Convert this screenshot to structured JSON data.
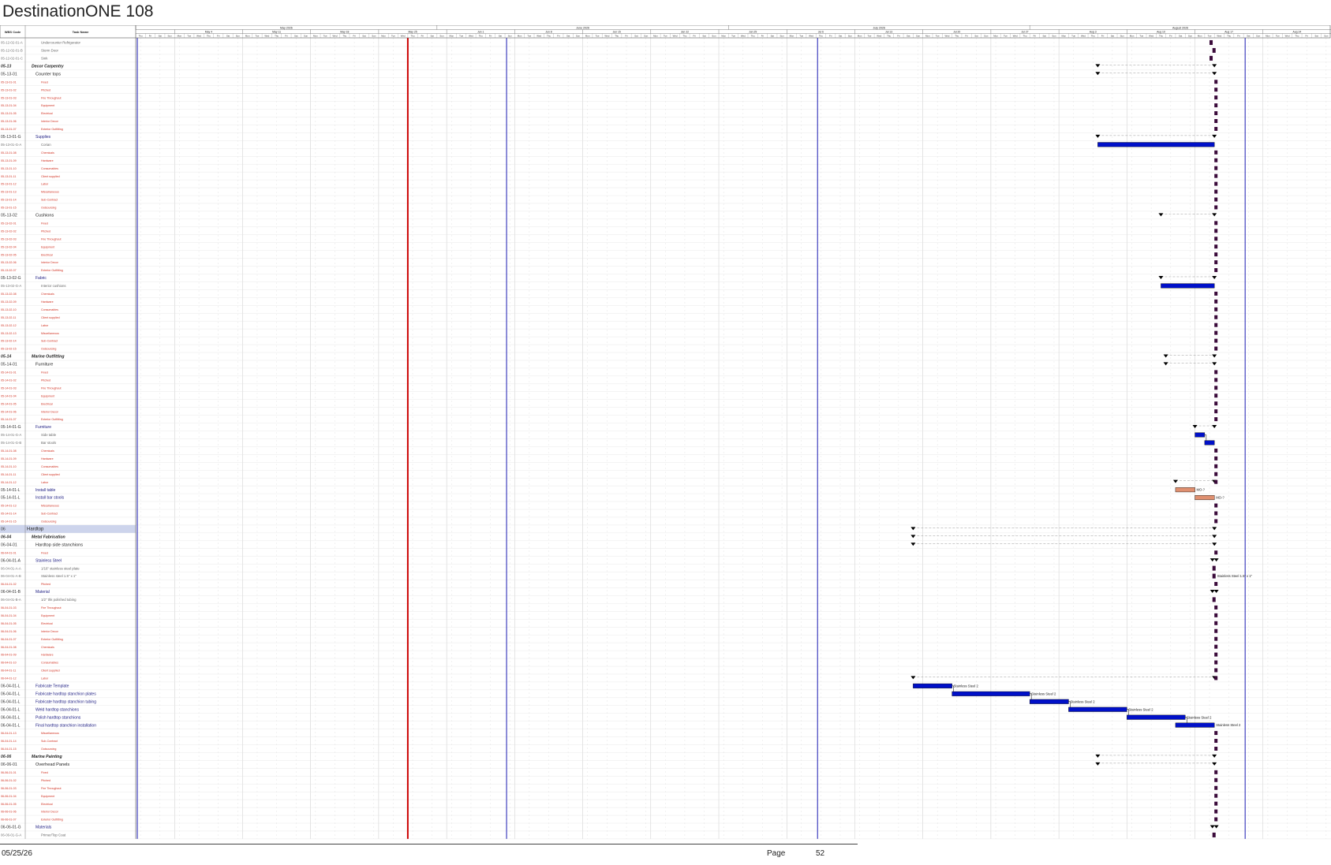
{
  "document": {
    "title": "DestinationONE 108",
    "date": "05/25/26",
    "page_label": "Page",
    "page_number": "52"
  },
  "table": {
    "col_wbs": "WBS Code",
    "col_task": "Task Name"
  },
  "colors": {
    "task_bar": "#0010c8",
    "summary_bar": "#000000",
    "progress_bar": "#e09070",
    "status_line": "#cc0000",
    "red_text": "#d03020",
    "blue_text": "#1a1a80",
    "highlight_row": "#cdd4ec",
    "date_line": "#0000aa"
  },
  "timescale": {
    "months": [
      {
        "label": "May 2026",
        "days": 31
      },
      {
        "label": "June 2026",
        "days": 30
      },
      {
        "label": "July 2026",
        "days": 31
      },
      {
        "label": "August 2026",
        "days": 31
      }
    ],
    "weeks": [
      "May 4",
      "May 11",
      "May 18",
      "May 25",
      "Jun 1",
      "Jun 8",
      "Jun 15",
      "Jun 22",
      "Jun 29",
      "Jul 6",
      "Jul 13",
      "Jul 20",
      "Jul 27",
      "Aug 3",
      "Aug 10",
      "Aug 17",
      "Aug 24"
    ],
    "week_start_day": 4,
    "day_labels": [
      "Mon",
      "Tue",
      "Wed",
      "Thu",
      "Fri",
      "Sat",
      "Sun"
    ],
    "status_date_day": 28,
    "period_lines_day": [
      0,
      38,
      70,
      114
    ]
  },
  "rows": [
    {
      "wbs": "05-12-02-01-A",
      "name": "Undercounter Refrigerator",
      "style": "g",
      "level": 3,
      "bar": {
        "t": "ms",
        "d": 110.5
      }
    },
    {
      "wbs": "05-12-02-01-B",
      "name": "Storm Door",
      "style": "g",
      "level": 3,
      "bar": {
        "t": "ms",
        "d": 110.8
      }
    },
    {
      "wbs": "05-12-02-01-C",
      "name": "Sink",
      "style": "g",
      "level": 3,
      "bar": {
        "t": "ms",
        "d": 110.5
      }
    },
    {
      "wbs": "05-13",
      "name": "Decor Carpentry",
      "style": "sum",
      "level": 1,
      "bar": {
        "t": "sum",
        "s": 99,
        "e": 111
      }
    },
    {
      "wbs": "05-13-01",
      "name": "Counter tops",
      "style": "sub",
      "level": 2,
      "bar": {
        "t": "sum",
        "s": 99,
        "e": 111
      }
    },
    {
      "wbs": "05-13-01-01",
      "name": "Fixed",
      "style": "r",
      "level": 3
    },
    {
      "wbs": "05-13-01-02",
      "name": "Pitched",
      "style": "r",
      "level": 3
    },
    {
      "wbs": "05-13-01-03",
      "name": "Fire Throughout",
      "style": "r",
      "level": 3
    },
    {
      "wbs": "05-13-01-04",
      "name": "Equipment",
      "style": "r",
      "level": 3
    },
    {
      "wbs": "05-13-01-05",
      "name": "Electrical",
      "style": "r",
      "level": 3
    },
    {
      "wbs": "05-13-01-06",
      "name": "Interior Decor",
      "style": "r",
      "level": 3
    },
    {
      "wbs": "05-13-01-07",
      "name": "Exterior Outfitting",
      "style": "r",
      "level": 3
    },
    {
      "wbs": "05-13-01-G",
      "name": "Supplies",
      "style": "b",
      "level": 2,
      "bar": {
        "t": "sum",
        "s": 99,
        "e": 111
      }
    },
    {
      "wbs": "05-13-01-G-A",
      "name": "Corian",
      "style": "g",
      "level": 3,
      "bar": {
        "t": "task",
        "s": 99,
        "e": 111
      }
    },
    {
      "wbs": "05-13-01-08",
      "name": "Chemicals",
      "style": "r",
      "level": 3
    },
    {
      "wbs": "05-13-01-09",
      "name": "Hardware",
      "style": "r",
      "level": 3
    },
    {
      "wbs": "05-13-01-10",
      "name": "Consumables",
      "style": "r",
      "level": 3
    },
    {
      "wbs": "05-13-01-11",
      "name": "Client supplied",
      "style": "r",
      "level": 3
    },
    {
      "wbs": "05-13-01-12",
      "name": "Labor",
      "style": "r",
      "level": 3
    },
    {
      "wbs": "05-13-01-13",
      "name": "Miscellaneous",
      "style": "r",
      "level": 3
    },
    {
      "wbs": "05-13-01-14",
      "name": "Sub-Contract",
      "style": "r",
      "level": 3
    },
    {
      "wbs": "05-13-01-15",
      "name": "Outsourcing",
      "style": "r",
      "level": 3
    },
    {
      "wbs": "05-13-02",
      "name": "Cushions",
      "style": "sub",
      "level": 2,
      "bar": {
        "t": "sum",
        "s": 105.5,
        "e": 111
      }
    },
    {
      "wbs": "05-13-02-01",
      "name": "Fixed",
      "style": "r",
      "level": 3
    },
    {
      "wbs": "05-13-02-02",
      "name": "Pitched",
      "style": "r",
      "level": 3
    },
    {
      "wbs": "05-13-02-03",
      "name": "Fire Throughout",
      "style": "r",
      "level": 3
    },
    {
      "wbs": "05-13-02-04",
      "name": "Equipment",
      "style": "r",
      "level": 3
    },
    {
      "wbs": "05-13-02-05",
      "name": "Electrical",
      "style": "r",
      "level": 3
    },
    {
      "wbs": "05-13-02-06",
      "name": "Interior Decor",
      "style": "r",
      "level": 3
    },
    {
      "wbs": "05-13-02-07",
      "name": "Exterior Outfitting",
      "style": "r",
      "level": 3
    },
    {
      "wbs": "05-13-02-G",
      "name": "Fabric",
      "style": "b",
      "level": 2,
      "bar": {
        "t": "sum",
        "s": 105.5,
        "e": 111
      }
    },
    {
      "wbs": "05-13-02-G-A",
      "name": "Interior cushions",
      "style": "g",
      "level": 3,
      "bar": {
        "t": "task",
        "s": 105.5,
        "e": 111
      }
    },
    {
      "wbs": "05-13-02-08",
      "name": "Chemicals",
      "style": "r",
      "level": 3
    },
    {
      "wbs": "05-13-02-09",
      "name": "Hardware",
      "style": "r",
      "level": 3
    },
    {
      "wbs": "05-13-02-10",
      "name": "Consumables",
      "style": "r",
      "level": 3
    },
    {
      "wbs": "05-13-02-11",
      "name": "Client supplied",
      "style": "r",
      "level": 3
    },
    {
      "wbs": "05-13-02-12",
      "name": "Labor",
      "style": "r",
      "level": 3
    },
    {
      "wbs": "05-13-02-13",
      "name": "Miscellaneous",
      "style": "r",
      "level": 3
    },
    {
      "wbs": "05-13-02-14",
      "name": "Sub-Contract",
      "style": "r",
      "level": 3
    },
    {
      "wbs": "05-13-02-15",
      "name": "Outsourcing",
      "style": "r",
      "level": 3
    },
    {
      "wbs": "05-14",
      "name": "Marine Outfitting",
      "style": "sum",
      "level": 1,
      "bar": {
        "t": "sum",
        "s": 106,
        "e": 111
      }
    },
    {
      "wbs": "05-14-01",
      "name": "Furniture",
      "style": "sub",
      "level": 2,
      "bar": {
        "t": "sum",
        "s": 106,
        "e": 111
      }
    },
    {
      "wbs": "05-14-01-01",
      "name": "Fixed",
      "style": "r",
      "level": 3
    },
    {
      "wbs": "05-14-01-02",
      "name": "Pitched",
      "style": "r",
      "level": 3
    },
    {
      "wbs": "05-14-01-03",
      "name": "Fire Throughout",
      "style": "r",
      "level": 3
    },
    {
      "wbs": "05-14-01-04",
      "name": "Equipment",
      "style": "r",
      "level": 3
    },
    {
      "wbs": "05-14-01-05",
      "name": "Electrical",
      "style": "r",
      "level": 3
    },
    {
      "wbs": "05-14-01-06",
      "name": "Interior Decor",
      "style": "r",
      "level": 3
    },
    {
      "wbs": "05-14-01-07",
      "name": "Exterior Outfitting",
      "style": "r",
      "level": 3
    },
    {
      "wbs": "05-14-01-G",
      "name": "Furniture",
      "style": "b",
      "level": 2,
      "bar": {
        "t": "sum",
        "s": 109,
        "e": 111
      }
    },
    {
      "wbs": "05-14-01-G-A",
      "name": "Side table",
      "style": "g",
      "level": 3,
      "bar": {
        "t": "task",
        "s": 109,
        "e": 110
      }
    },
    {
      "wbs": "05-14-01-G-B",
      "name": "Bar stools",
      "style": "g",
      "level": 3,
      "bar": {
        "t": "task",
        "s": 110,
        "e": 111
      }
    },
    {
      "wbs": "05-14-01-08",
      "name": "Chemicals",
      "style": "r",
      "level": 3
    },
    {
      "wbs": "05-14-01-09",
      "name": "Hardware",
      "style": "r",
      "level": 3
    },
    {
      "wbs": "05-14-01-10",
      "name": "Consumables",
      "style": "r",
      "level": 3
    },
    {
      "wbs": "05-14-01-11",
      "name": "Client supplied",
      "style": "r",
      "level": 3
    },
    {
      "wbs": "05-14-01-12",
      "name": "Labor",
      "style": "r",
      "level": 3,
      "bar": {
        "t": "sum",
        "s": 107,
        "e": 111
      }
    },
    {
      "wbs": "05-14-01-L",
      "name": "Install table",
      "style": "b",
      "level": 2,
      "bar": {
        "t": "prog",
        "s": 107,
        "e": 109
      },
      "label": "MO-?"
    },
    {
      "wbs": "05-14-01-L",
      "name": "Install bar stools",
      "style": "b",
      "level": 2,
      "bar": {
        "t": "prog",
        "s": 109,
        "e": 111
      },
      "label": "MO-?"
    },
    {
      "wbs": "05-14-01-13",
      "name": "Miscellaneous",
      "style": "r",
      "level": 3
    },
    {
      "wbs": "05-14-01-14",
      "name": "Sub-Contract",
      "style": "r",
      "level": 3
    },
    {
      "wbs": "05-14-01-15",
      "name": "Outsourcing",
      "style": "r",
      "level": 3
    },
    {
      "wbs": "06",
      "name": "Hardtop",
      "style": "top",
      "level": 0,
      "bar": {
        "t": "sum",
        "s": 80,
        "e": 111
      }
    },
    {
      "wbs": "06-04",
      "name": "Metal Fabrication",
      "style": "sum",
      "level": 1,
      "bar": {
        "t": "sum",
        "s": 80,
        "e": 111
      }
    },
    {
      "wbs": "06-04-01",
      "name": "Hardtop side stanchions",
      "style": "sub",
      "level": 2,
      "bar": {
        "t": "sum",
        "s": 80,
        "e": 111
      }
    },
    {
      "wbs": "06-04-01-01",
      "name": "Fixed",
      "style": "r",
      "level": 3
    },
    {
      "wbs": "06-04-01-A",
      "name": "Stainless Steel",
      "style": "b",
      "level": 2,
      "bar": {
        "t": "sum",
        "s": 110.8,
        "e": 111.2
      }
    },
    {
      "wbs": "06-04-01-A-A",
      "name": "1/16\" stainless steel plate",
      "style": "g",
      "level": 3,
      "bar": {
        "t": "ms",
        "d": 110.8
      }
    },
    {
      "wbs": "06-04-01-A-B",
      "name": "Stainless steel 1.5\" x 1\"",
      "style": "g",
      "level": 3,
      "bar": {
        "t": "ms",
        "d": 110.8
      },
      "label": "Stainless Steel 1.5\" x 1\""
    },
    {
      "wbs": "06-04-01-02",
      "name": "Pitched",
      "style": "r",
      "level": 3
    },
    {
      "wbs": "06-04-01-B",
      "name": "Material",
      "style": "b",
      "level": 2,
      "bar": {
        "t": "sum",
        "s": 110.8,
        "e": 111.2
      }
    },
    {
      "wbs": "06-04-01-B-A",
      "name": "1/2\" thk polished tubing",
      "style": "g",
      "level": 3,
      "bar": {
        "t": "ms",
        "d": 110.8
      }
    },
    {
      "wbs": "06-04-01-03",
      "name": "Fire Throughout",
      "style": "r",
      "level": 3
    },
    {
      "wbs": "06-04-01-04",
      "name": "Equipment",
      "style": "r",
      "level": 3
    },
    {
      "wbs": "06-04-01-05",
      "name": "Electrical",
      "style": "r",
      "level": 3
    },
    {
      "wbs": "06-04-01-06",
      "name": "Interior Decor",
      "style": "r",
      "level": 3
    },
    {
      "wbs": "06-04-01-07",
      "name": "Exterior Outfitting",
      "style": "r",
      "level": 3
    },
    {
      "wbs": "06-04-01-08",
      "name": "Chemicals",
      "style": "r",
      "level": 3
    },
    {
      "wbs": "06-04-01-09",
      "name": "Hardware",
      "style": "r",
      "level": 3
    },
    {
      "wbs": "06-04-01-10",
      "name": "Consumables",
      "style": "r",
      "level": 3
    },
    {
      "wbs": "06-04-01-11",
      "name": "Client supplied",
      "style": "r",
      "level": 3
    },
    {
      "wbs": "06-04-01-12",
      "name": "Labor",
      "style": "r",
      "level": 3,
      "bar": {
        "t": "sum",
        "s": 80,
        "e": 111
      }
    },
    {
      "wbs": "06-04-01-L",
      "name": "Fabricate Template",
      "style": "b",
      "level": 2,
      "bar": {
        "t": "task",
        "s": 80,
        "e": 84
      },
      "label": "Stainless Steel 2"
    },
    {
      "wbs": "06-04-01-L",
      "name": "Fabricate hardtop stanchion plates",
      "style": "b",
      "level": 2,
      "bar": {
        "t": "task",
        "s": 84,
        "e": 92
      },
      "label": "Stainless Steel 2"
    },
    {
      "wbs": "06-04-01-L",
      "name": "Fabricate hardtop stanchion tubing",
      "style": "b",
      "level": 2,
      "bar": {
        "t": "task",
        "s": 92,
        "e": 96
      },
      "label": "Stainless Steel 2"
    },
    {
      "wbs": "06-04-01-L",
      "name": "Weld hardtop stanchions",
      "style": "b",
      "level": 2,
      "bar": {
        "t": "task",
        "s": 96,
        "e": 102
      },
      "label": "Stainless Steel 2"
    },
    {
      "wbs": "06-04-01-L",
      "name": "Polish hardtop stanchions",
      "style": "b",
      "level": 2,
      "bar": {
        "t": "task",
        "s": 102,
        "e": 108
      },
      "label": "Stainless Steel 2"
    },
    {
      "wbs": "06-04-01-L",
      "name": "Final hardtop stanchion installation",
      "style": "b",
      "level": 2,
      "bar": {
        "t": "task",
        "s": 107,
        "e": 111
      },
      "label": "Stainless Steel 2"
    },
    {
      "wbs": "06-04-01-13",
      "name": "Miscellaneous",
      "style": "r",
      "level": 3
    },
    {
      "wbs": "06-04-01-14",
      "name": "Sub-Contract",
      "style": "r",
      "level": 3
    },
    {
      "wbs": "06-04-01-15",
      "name": "Outsourcing",
      "style": "r",
      "level": 3
    },
    {
      "wbs": "06-06",
      "name": "Marine Painting",
      "style": "sum",
      "level": 1,
      "bar": {
        "t": "sum",
        "s": 99,
        "e": 111
      }
    },
    {
      "wbs": "06-06-01",
      "name": "Overhead Panels",
      "style": "sub",
      "level": 2,
      "bar": {
        "t": "sum",
        "s": 99,
        "e": 111
      }
    },
    {
      "wbs": "06-06-01-01",
      "name": "Fixed",
      "style": "r",
      "level": 3
    },
    {
      "wbs": "06-06-01-02",
      "name": "Pitched",
      "style": "r",
      "level": 3
    },
    {
      "wbs": "06-06-01-03",
      "name": "Fire Throughout",
      "style": "r",
      "level": 3
    },
    {
      "wbs": "06-06-01-04",
      "name": "Equipment",
      "style": "r",
      "level": 3
    },
    {
      "wbs": "06-06-01-05",
      "name": "Electrical",
      "style": "r",
      "level": 3
    },
    {
      "wbs": "06-06-01-06",
      "name": "Interior Decor",
      "style": "r",
      "level": 3
    },
    {
      "wbs": "06-06-01-07",
      "name": "Exterior Outfitting",
      "style": "r",
      "level": 3
    },
    {
      "wbs": "06-06-01-G",
      "name": "Materials",
      "style": "b",
      "level": 2,
      "bar": {
        "t": "sum",
        "s": 110.8,
        "e": 111.2
      }
    },
    {
      "wbs": "06-06-01-G-A",
      "name": "Primer/Top Coat",
      "style": "g",
      "level": 3,
      "bar": {
        "t": "ms",
        "d": 110.8
      }
    }
  ]
}
